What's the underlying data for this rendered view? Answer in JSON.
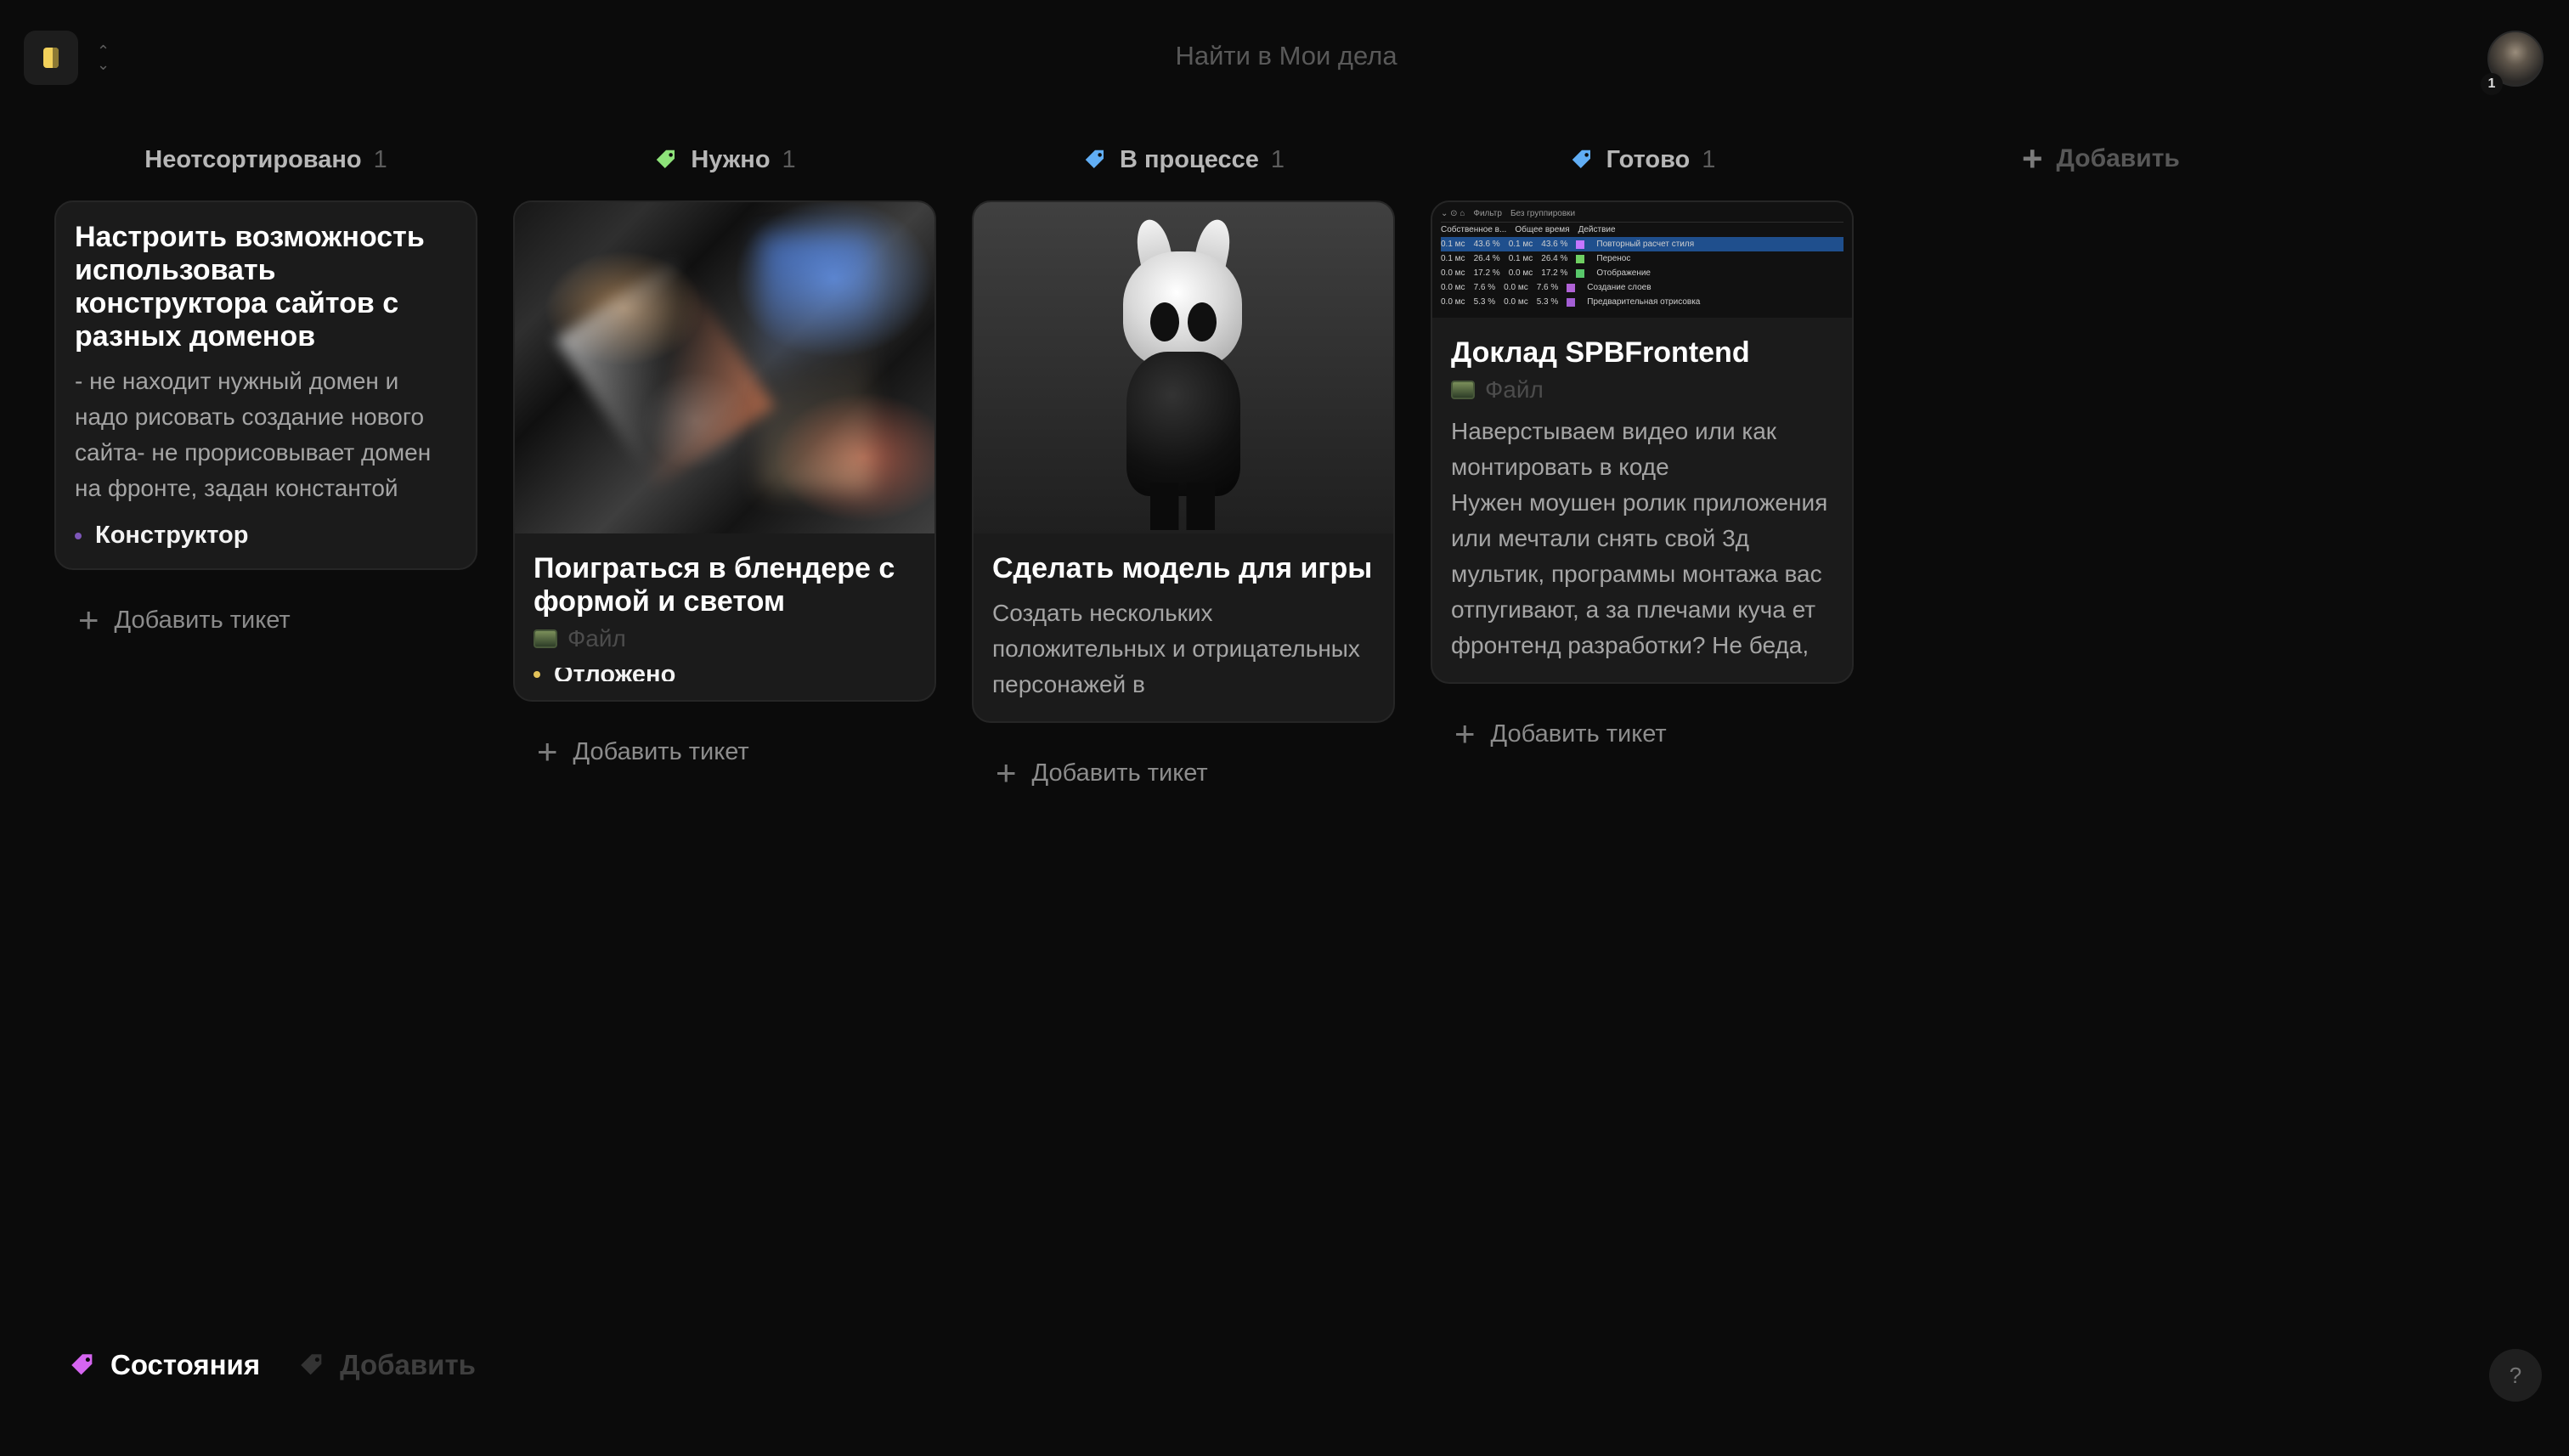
{
  "topbar": {
    "search_placeholder": "Найти в Мои дела",
    "avatar_badge": "1"
  },
  "columns": [
    {
      "title": "Неотсортировано",
      "count": "1",
      "color": "",
      "add_ticket": "Добавить тикет",
      "cards": [
        {
          "title": "Настроить возможность использовать конструктора сайтов с разных доменов",
          "text": "- не находит нужный домен и надо рисовать создание нового сайта- не прорисовывает домен на фронте, задан константой",
          "tag": "Конструктор"
        }
      ]
    },
    {
      "title": "Нужно",
      "count": "1",
      "color": "#8ee37a",
      "add_ticket": "Добавить тикет",
      "cards": [
        {
          "title": "Поиграться в блендере с формой и светом",
          "file": "Файл",
          "tag": "Отложено"
        }
      ]
    },
    {
      "title": "В процессе",
      "count": "1",
      "color": "#61aef5",
      "add_ticket": "Добавить тикет",
      "cards": [
        {
          "title": "Сделать модель для игры",
          "text": "Создать нескольких положительных и отрицательных персонажей в"
        }
      ]
    },
    {
      "title": "Готово",
      "count": "1",
      "color": "#61aef5",
      "add_ticket": "Добавить тикет",
      "cards": [
        {
          "title": "Доклад SPBFrontend",
          "file": "Файл",
          "text": "Наверстываем видео или как монтировать в коде\nНужен моушен ролик приложения или мечтали снять свой 3д мультик, программы монтажа вас отпугивают, а за плечами куча ет фронтенд разработки? Не беда,"
        }
      ]
    }
  ],
  "add_column": "Добавить",
  "footer": {
    "states_label": "Состояния",
    "add_label": "Добавить"
  },
  "help": "?",
  "perf_preview": {
    "toolbar": [
      "Фильтр",
      "Без группировки"
    ],
    "headers": [
      "Собственное в...",
      "Общее время",
      "Действие"
    ],
    "rows": [
      [
        "0.1 мс",
        "43.6 %",
        "0.1 мс",
        "43.6 %",
        "Повторный расчет стиля"
      ],
      [
        "0.1 мс",
        "26.4 %",
        "0.1 мс",
        "26.4 %",
        "Перенос"
      ],
      [
        "0.0 мс",
        "17.2 %",
        "0.0 мс",
        "17.2 %",
        "Отображение"
      ],
      [
        "0.0 мс",
        "7.6 %",
        "0.0 мс",
        "7.6 %",
        "Создание слоев"
      ],
      [
        "0.0 мс",
        "5.3 %",
        "0.0 мс",
        "5.3 %",
        "Предварительная отрисовка"
      ]
    ]
  }
}
